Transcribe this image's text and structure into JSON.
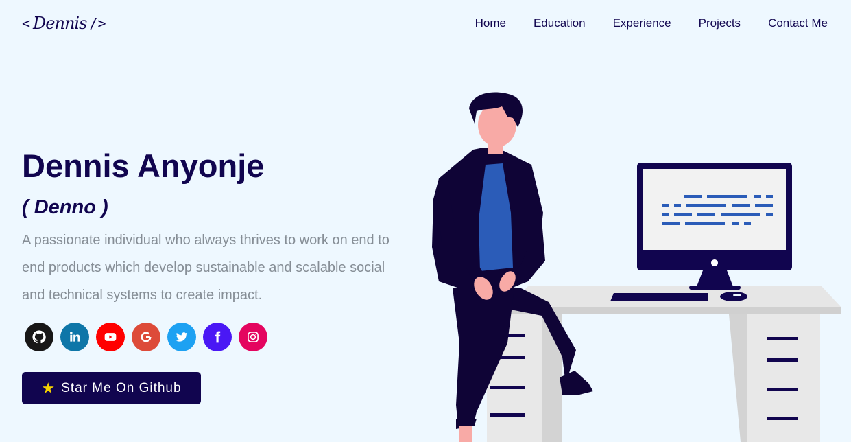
{
  "header": {
    "logo": {
      "open": "<",
      "signature": "Dennis",
      "close": "/>"
    },
    "nav": [
      "Home",
      "Education",
      "Experience",
      "Projects",
      "Contact Me"
    ]
  },
  "hero": {
    "name": "Dennis Anyonje",
    "nickname": "( Denno )",
    "description": "A passionate individual who always thrives to work on end to end products which develop sustainable and scalable social and technical systems to create impact.",
    "socials": [
      {
        "name": "github-icon",
        "color": "#181717"
      },
      {
        "name": "linkedin-icon",
        "color": "#0e76a8"
      },
      {
        "name": "youtube-icon",
        "color": "#ff0000"
      },
      {
        "name": "google-icon",
        "color": "#dd4b39"
      },
      {
        "name": "twitter-icon",
        "color": "#1da1f2"
      },
      {
        "name": "facebook-icon",
        "color": "#4a18f5"
      },
      {
        "name": "instagram-icon",
        "color": "#e4405f"
      }
    ],
    "star_button": {
      "icon": "star-icon",
      "label": "Star Me On Github"
    }
  },
  "colors": {
    "background": "#eef8ff",
    "primary": "#11054f",
    "muted_text": "#868e96",
    "accent_blue": "#2b5cb8"
  }
}
